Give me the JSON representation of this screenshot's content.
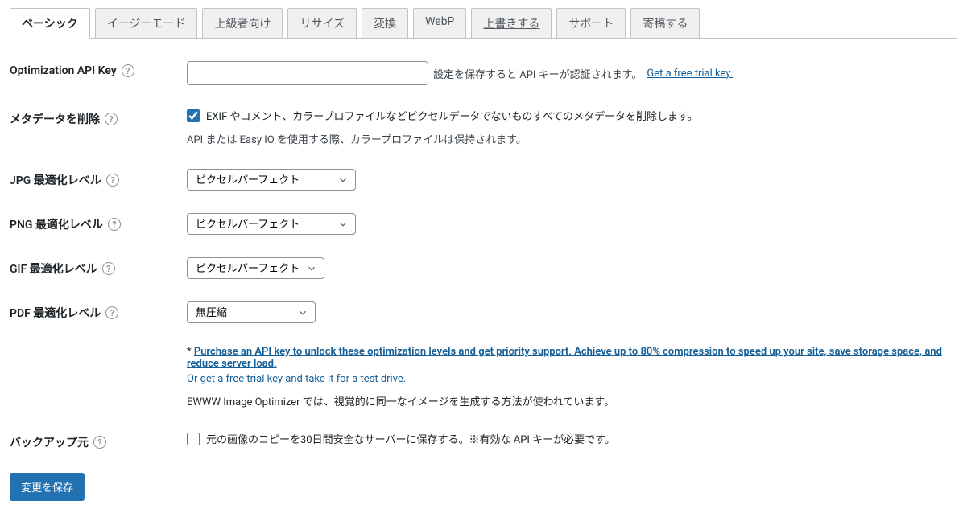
{
  "tabs": {
    "basic": "ベーシック",
    "easy": "イージーモード",
    "advanced": "上級者向け",
    "resize": "リサイズ",
    "convert": "変換",
    "webp": "WebP",
    "overwrite": "上書きする",
    "support": "サポート",
    "contribute": "寄稿する"
  },
  "fields": {
    "api_key": {
      "label": "Optimization API Key",
      "value": "",
      "desc": "設定を保存すると API キーが認証されます。",
      "link": "Get a free trial key."
    },
    "metadata": {
      "label": "メタデータを削除",
      "checked": true,
      "checkbox_label": "EXIF やコメント、カラープロファイルなどピクセルデータでないものすべてのメタデータを削除します。",
      "sub_desc": "API または Easy IO を使用する際、カラープロファイルは保持されます。"
    },
    "jpg_level": {
      "label": "JPG 最適化レベル",
      "value": "ピクセルパーフェクト"
    },
    "png_level": {
      "label": "PNG 最適化レベル",
      "value": "ピクセルパーフェクト"
    },
    "gif_level": {
      "label": "GIF 最適化レベル",
      "value": "ピクセルパーフェクト"
    },
    "pdf_level": {
      "label": "PDF 最適化レベル",
      "value": "無圧縮"
    },
    "backup": {
      "label": "バックアップ元",
      "checked": false,
      "checkbox_label": "元の画像のコピーを30日間安全なサーバーに保存する。※有効な API キーが必要です。"
    }
  },
  "info": {
    "asterisk": "* ",
    "purchase_link": "Purchase an API key to unlock these optimization levels and get priority support. Achieve up to 80% compression to speed up your site, save storage space, and reduce server load. ",
    "trial_link": "Or get a free trial key and take it for a test drive.",
    "plain": "EWWW Image Optimizer では、視覚的に同一なイメージを生成する方法が使われています。"
  },
  "buttons": {
    "save": "変更を保存"
  },
  "icons": {
    "help": "?"
  }
}
